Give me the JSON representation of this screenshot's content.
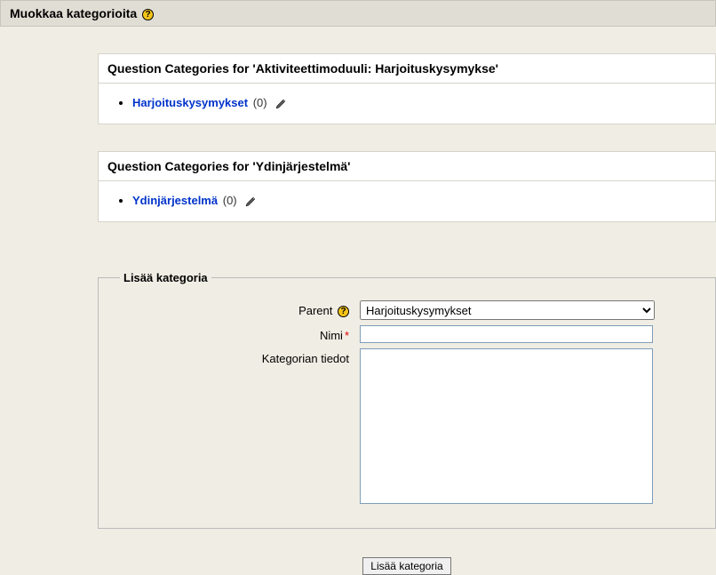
{
  "header": {
    "title": "Muokkaa kategorioita"
  },
  "boxes": [
    {
      "header": "Question Categories for 'Aktiviteettimoduuli: Harjoituskysymykse'",
      "items": [
        {
          "name": "Harjoituskysymykset",
          "count": "(0)"
        }
      ]
    },
    {
      "header": "Question Categories for 'Ydinjärjestelmä'",
      "items": [
        {
          "name": "Ydinjärjestelmä",
          "count": "(0)"
        }
      ]
    }
  ],
  "form": {
    "legend": "Lisää kategoria",
    "labels": {
      "parent": "Parent",
      "name": "Nimi",
      "info": "Kategorian tiedot"
    },
    "parent_selected": "Harjoituskysymykset",
    "name_value": "",
    "info_value": "",
    "submit_label": "Lisää kategoria"
  }
}
